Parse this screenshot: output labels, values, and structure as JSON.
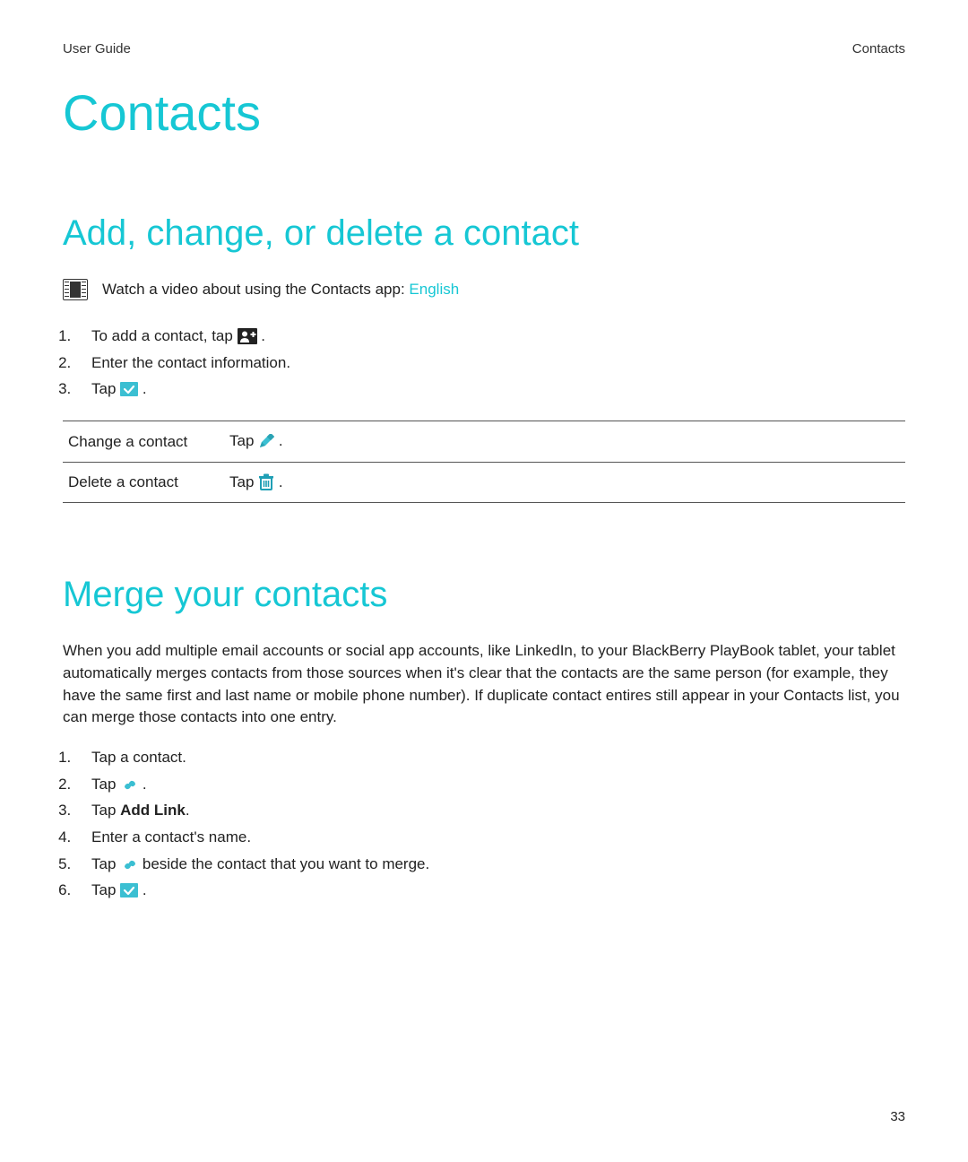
{
  "header": {
    "left": "User Guide",
    "right": "Contacts"
  },
  "title": "Contacts",
  "section1": {
    "heading": "Add, change, or delete a contact",
    "video_prefix": "Watch a video about using the Contacts app: ",
    "video_link": "English",
    "steps": {
      "s1_a": "To add a contact, tap ",
      "s1_b": " .",
      "s2": "Enter the contact information.",
      "s3_a": "Tap ",
      "s3_b": " ."
    },
    "table": {
      "r1_label": "Change a contact",
      "r1_a": "Tap ",
      "r1_b": " .",
      "r2_label": "Delete a contact",
      "r2_a": "Tap ",
      "r2_b": " ."
    }
  },
  "section2": {
    "heading": "Merge your contacts",
    "paragraph": "When you add multiple email accounts or social app accounts, like LinkedIn, to your BlackBerry PlayBook tablet, your tablet automatically merges contacts from those sources when it's clear that the contacts are the same person (for example, they have the same first and last name or mobile phone number). If duplicate contact entires still appear in your Contacts list, you can merge those contacts into one entry.",
    "steps": {
      "s1": "Tap a contact.",
      "s2_a": "Tap ",
      "s2_b": " .",
      "s3_a": "Tap ",
      "s3_bold": "Add Link",
      "s3_b": ".",
      "s4": "Enter a contact's name.",
      "s5_a": "Tap ",
      "s5_b": " beside the contact that you want to merge.",
      "s6_a": "Tap ",
      "s6_b": " ."
    }
  },
  "page_number": "33"
}
